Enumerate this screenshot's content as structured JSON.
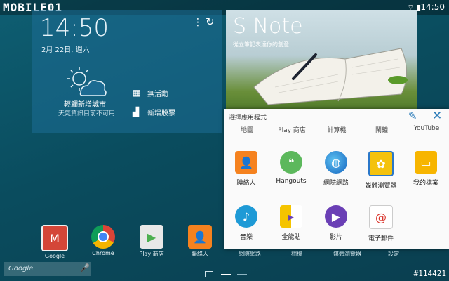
{
  "statusbar": {
    "logo": "MOBILE01",
    "time": "14:50"
  },
  "weather": {
    "time": "14:50",
    "date": "2月 22日, 週六",
    "city": "輕觸新增城市",
    "condition": "天氣資訊目前不可用",
    "events": "無活動",
    "stocks": "新增股票"
  },
  "snote": {
    "title": "S Note",
    "subtitle": "從立筆記表達你的創意"
  },
  "dialog": {
    "title": "選擇應用程式",
    "tabs": [
      "地圖",
      "Play 商店",
      "計算機",
      "鬧鐘",
      "YouTube"
    ],
    "apps_row1": [
      {
        "label": "聯絡人",
        "icon": "contacts-icon",
        "color": "#f5821f"
      },
      {
        "label": "Hangouts",
        "icon": "hangouts-icon",
        "color": "#5cb85c"
      },
      {
        "label": "網際網路",
        "icon": "internet-globe-icon",
        "color": "#1e88c8"
      },
      {
        "label": "媒體瀏覽器",
        "icon": "gallery-icon",
        "color": "#f4c20d"
      },
      {
        "label": "我的檔案",
        "icon": "folder-icon",
        "color": "#f7b500"
      }
    ],
    "apps_row2": [
      {
        "label": "音樂",
        "icon": "music-icon",
        "color": "#1e9ad6"
      },
      {
        "label": "全能貼",
        "icon": "scrapbook-icon",
        "color": "#f5c400"
      },
      {
        "label": "影片",
        "icon": "video-icon",
        "color": "#6a3fb5"
      },
      {
        "label": "電子郵件",
        "icon": "email-icon",
        "color": "#ffffff"
      }
    ]
  },
  "dock": [
    {
      "label": "Google",
      "icon": "gmail-icon"
    },
    {
      "label": "Chrome",
      "icon": "chrome-icon"
    },
    {
      "label": "Play 商店",
      "icon": "play-store-icon"
    },
    {
      "label": "聯絡人",
      "icon": "contacts-icon"
    },
    {
      "label": "網際網路",
      "icon": "internet-icon"
    },
    {
      "label": "相機",
      "icon": "camera-icon"
    },
    {
      "label": "媒體瀏覽器",
      "icon": "gallery-icon"
    },
    {
      "label": "設定",
      "icon": "settings-icon"
    }
  ],
  "search": {
    "placeholder": "Google"
  },
  "watermark": "#114421"
}
